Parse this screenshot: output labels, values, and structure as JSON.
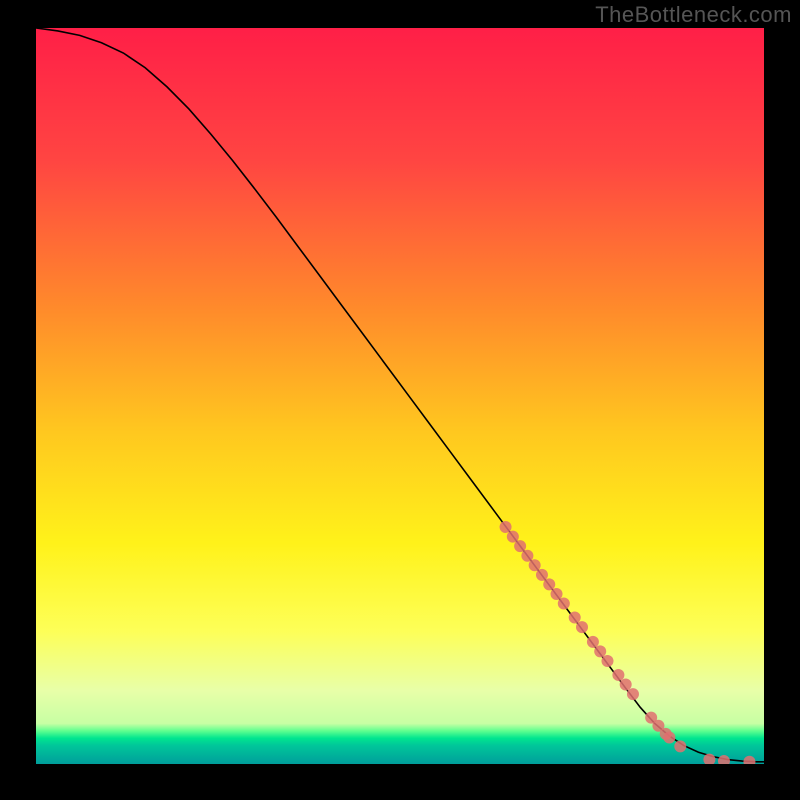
{
  "watermark": "TheBottleneck.com",
  "chart_data": {
    "type": "line",
    "title": "",
    "xlabel": "",
    "ylabel": "",
    "xlim": [
      0,
      100
    ],
    "ylim": [
      0,
      100
    ],
    "background_gradient_stops": [
      {
        "offset": 0.0,
        "color": "#ff1f47"
      },
      {
        "offset": 0.18,
        "color": "#ff4542"
      },
      {
        "offset": 0.38,
        "color": "#ff8a2b"
      },
      {
        "offset": 0.55,
        "color": "#ffc81f"
      },
      {
        "offset": 0.7,
        "color": "#fff21a"
      },
      {
        "offset": 0.82,
        "color": "#fdff58"
      },
      {
        "offset": 0.9,
        "color": "#e8ffa8"
      },
      {
        "offset": 0.945,
        "color": "#c7ffa4"
      },
      {
        "offset": 0.955,
        "color": "#5fff8f"
      },
      {
        "offset": 0.965,
        "color": "#00e58f"
      },
      {
        "offset": 0.975,
        "color": "#00c69a"
      },
      {
        "offset": 1.0,
        "color": "#009e9b"
      }
    ],
    "series": [
      {
        "name": "curve",
        "type": "line",
        "color": "#000000",
        "x": [
          0,
          3,
          6,
          9,
          12,
          15,
          18,
          21,
          24,
          27,
          30,
          33,
          36,
          39,
          42,
          45,
          48,
          51,
          54,
          57,
          60,
          63,
          66,
          69,
          72,
          75,
          78,
          81,
          83,
          85,
          87,
          89,
          91,
          93,
          95,
          97,
          99,
          100
        ],
        "y": [
          100,
          99.6,
          99.0,
          98.0,
          96.6,
          94.6,
          92.0,
          89.0,
          85.6,
          82.0,
          78.2,
          74.3,
          70.3,
          66.3,
          62.3,
          58.3,
          54.3,
          50.3,
          46.3,
          42.3,
          38.3,
          34.3,
          30.3,
          26.3,
          22.3,
          18.3,
          14.3,
          10.3,
          7.7,
          5.5,
          3.8,
          2.5,
          1.6,
          1.0,
          0.6,
          0.4,
          0.3,
          0.3
        ]
      },
      {
        "name": "markers",
        "type": "scatter",
        "color": "#e07070",
        "x": [
          64.5,
          65.5,
          66.5,
          67.5,
          68.5,
          69.5,
          70.5,
          71.5,
          72.5,
          74.0,
          75.0,
          76.5,
          77.5,
          78.5,
          80.0,
          81.0,
          82.0,
          84.5,
          85.5,
          86.5,
          87.0,
          88.5,
          92.5,
          94.5,
          98.0
        ],
        "y": [
          32.2,
          30.9,
          29.6,
          28.3,
          27.0,
          25.7,
          24.4,
          23.1,
          21.8,
          19.9,
          18.6,
          16.6,
          15.3,
          14.0,
          12.1,
          10.8,
          9.5,
          6.3,
          5.2,
          4.1,
          3.6,
          2.4,
          0.6,
          0.4,
          0.3
        ]
      }
    ]
  }
}
